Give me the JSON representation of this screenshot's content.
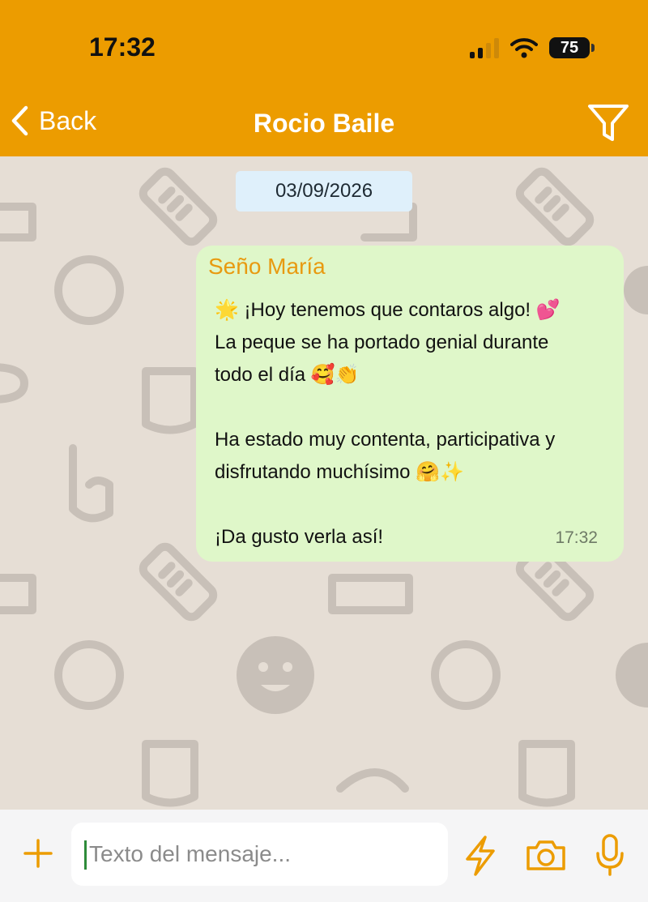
{
  "status_bar": {
    "time": "17:32",
    "battery": "75"
  },
  "nav": {
    "back_label": "Back",
    "title": "Rocio Baile"
  },
  "chat": {
    "date": "03/09/2026",
    "messages": [
      {
        "sender": "Seño María",
        "lines": [
          "🌟 ¡Hoy tenemos que contaros algo! 💕",
          "La peque se ha portado genial durante",
          "todo el día 🥰👏",
          "",
          "Ha estado muy contenta, participativa y",
          "disfrutando muchísimo 🤗✨",
          "",
          "¡Da gusto verla así!"
        ],
        "time": "17:32"
      }
    ]
  },
  "composer": {
    "placeholder": "Texto del mensaje..."
  },
  "colors": {
    "header": "#ec9c00",
    "bubble": "#dff7c9",
    "sender": "#e89a10",
    "accent": "#ec9c00"
  },
  "icons": [
    "chevron-left-icon",
    "filter-icon",
    "plus-icon",
    "lightning-icon",
    "camera-icon",
    "microphone-icon",
    "signal-icon",
    "wifi-icon",
    "battery-icon"
  ]
}
